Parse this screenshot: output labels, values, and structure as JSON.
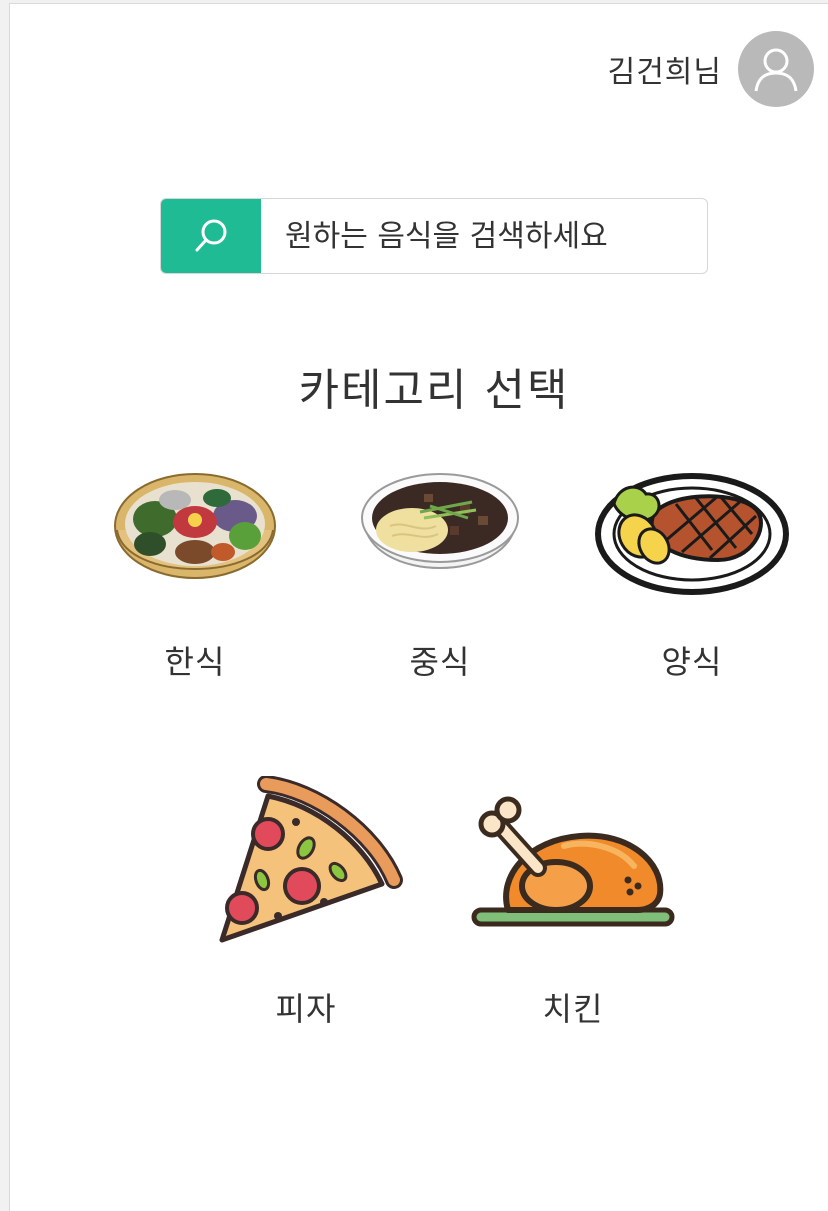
{
  "header": {
    "user_name": "김건희님",
    "avatar_icon": "user-avatar-icon"
  },
  "search": {
    "placeholder": "원하는 음식을 검색하세요",
    "icon": "search-icon",
    "button_color": "#1fbb94"
  },
  "section": {
    "title": "카테고리 선택"
  },
  "categories": [
    {
      "label": "한식",
      "icon": "bibimbap-icon"
    },
    {
      "label": "중식",
      "icon": "jjajangmyeon-icon"
    },
    {
      "label": "양식",
      "icon": "steak-icon"
    },
    {
      "label": "피자",
      "icon": "pizza-icon"
    },
    {
      "label": "치킨",
      "icon": "roast-chicken-icon"
    }
  ]
}
